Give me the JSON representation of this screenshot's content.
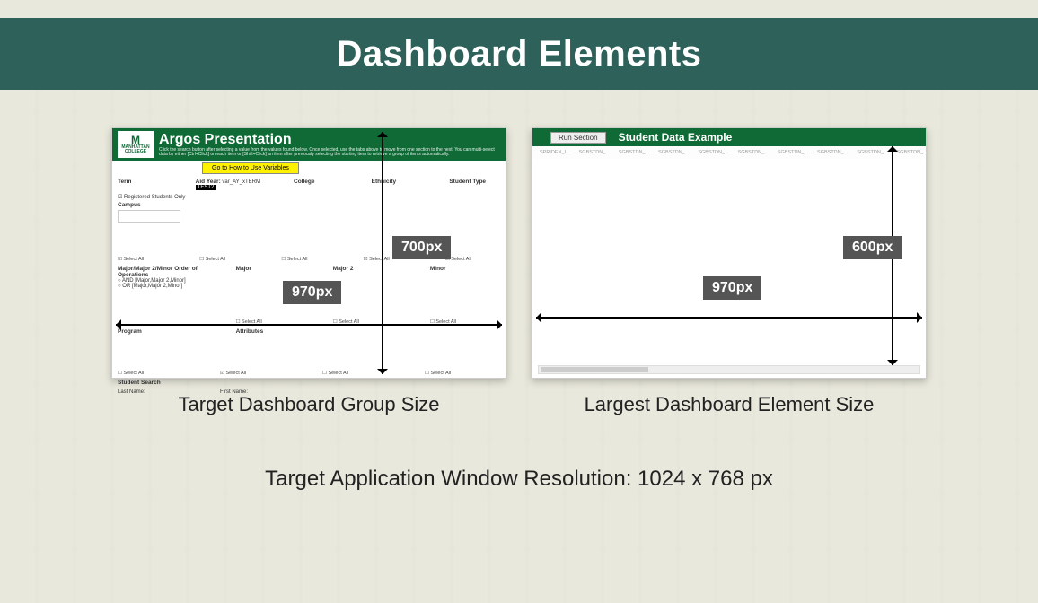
{
  "title": "Dashboard Elements",
  "leftPanel": {
    "logoTop": "M",
    "logoLine1": "MANHATTAN",
    "logoLine2": "COLLEGE",
    "appTitle": "Argos Presentation",
    "sub": "Click the search button after selecting a value from the values found below. Once selected, use the tabs above to move from one section to the next. You can multi-select data by either [Ctrl+Click] on each item or [Shift+Click] an item after previously selecting the starting item to retrieve a group of items automatically.",
    "yellowBtn": "Go to How to Use Variables",
    "fields": {
      "term": "Term",
      "aidYear": "Aid Year:",
      "aidYearVal": "var_AY_xTERM",
      "aidYearVal2": "TEST2",
      "college": "College",
      "ethnicity": "Ethnicity",
      "studentType": "Student Type",
      "regOnly": "Registered Students Only",
      "campus": "Campus",
      "selectAll": "Select All",
      "majorHeader": "Major/Major 2/Minor Order of Operations",
      "opAnd": "AND [Major,Major 2,Minor]",
      "opOr": "OR [Major,Major 2,Minor]",
      "major": "Major",
      "major2": "Major 2",
      "minor": "Minor",
      "program": "Program",
      "attributes": "Attributes",
      "studentSearch": "Student Search",
      "lastName": "Last Name:",
      "firstName": "First Name:"
    },
    "dimH": "970px",
    "dimV": "700px",
    "caption": "Target Dashboard Group Size"
  },
  "rightPanel": {
    "runSection": "Run Section",
    "title": "Student Data Example",
    "columns": [
      "SPRIDEN_I...",
      "SGBSTDN_...",
      "SGBSTDN_...",
      "SGBSTDN_...",
      "SGBSTDN_...",
      "SGBSTDN_...",
      "SGBSTDN_...",
      "SGBSTDN_...",
      "SGBSTDN_...",
      "SGBSTDN_..."
    ],
    "dimH": "970px",
    "dimV": "600px",
    "caption": "Largest Dashboard Element Size"
  },
  "footer": "Target Application Window Resolution: 1024 x 768 px"
}
